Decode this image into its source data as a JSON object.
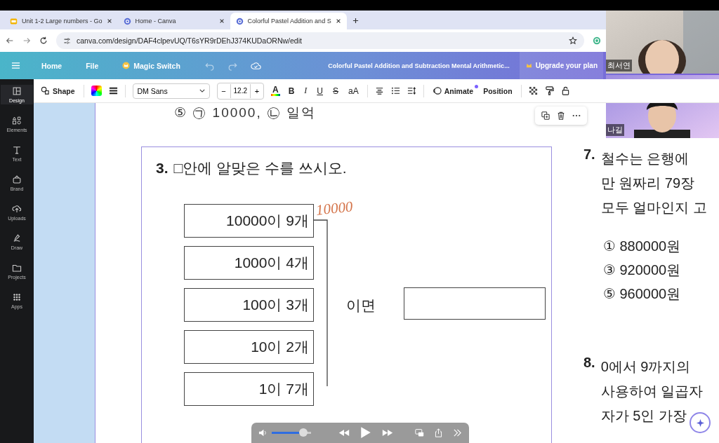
{
  "browser": {
    "tabs": [
      {
        "title": "Unit 1-2 Large numbers - Go",
        "kind": "slides",
        "selected": false
      },
      {
        "title": "Home - Canva",
        "kind": "canva",
        "selected": false
      },
      {
        "title": "Colorful Pastel Addition and S",
        "kind": "canva",
        "selected": true
      }
    ],
    "url": "canva.com/design/DAF4clpevUQ/T6sYR9rDEhJ374KUDaORNw/edit"
  },
  "editor_header": {
    "menu": [
      {
        "label": "Home",
        "kind": "plain"
      },
      {
        "label": "File",
        "kind": "plain"
      },
      {
        "label": "Magic Switch",
        "kind": "crown"
      }
    ],
    "doc_title": "Colorful Pastel Addition and Subtraction Mental Arithmetic...",
    "upgrade": "Upgrade your plan"
  },
  "toolbar": {
    "shape": "Shape",
    "font": "DM Sans",
    "minus": "−",
    "font_size": "12.2",
    "plus": "+",
    "text_color": "A",
    "formats": [
      "B",
      "I",
      "U",
      "S",
      "aA"
    ],
    "animate": "Animate",
    "position": "Position"
  },
  "sidebar": [
    {
      "label": "Design",
      "selected": true
    },
    {
      "label": "Elements",
      "selected": false
    },
    {
      "label": "Text",
      "selected": false
    },
    {
      "label": "Brand",
      "selected": false
    },
    {
      "label": "Uploads",
      "selected": false
    },
    {
      "label": "Draw",
      "selected": false
    },
    {
      "label": "Projects",
      "selected": false
    },
    {
      "label": "Apps",
      "selected": false
    }
  ],
  "page": {
    "cut_line": "⑤ ㉠ 10000,  ㉡ 일억",
    "question": {
      "number": "3.",
      "text": "□안에 알맞은 수를 쓰시오.",
      "rows": [
        "10000이 9개",
        "1000이 4개",
        "100이 3개",
        "10이 2개",
        "1이 7개"
      ],
      "handwriting": "10000",
      "connector": "이면"
    },
    "right": [
      {
        "kind": "question",
        "number": "7.",
        "lines": [
          "철수는  은행에",
          "만  원짜리  79장",
          "모두  얼마인지  고"
        ]
      },
      {
        "kind": "options",
        "lines": [
          "①  880000원",
          "③  920000원",
          "⑤  960000원"
        ]
      },
      {
        "kind": "question",
        "number": "8.",
        "lines": [
          "0에서  9까지의",
          "사용하여  일곱자",
          "자가  5인  가장"
        ]
      }
    ]
  },
  "video_tiles": [
    {
      "name": "최서연",
      "kind": "room"
    },
    {
      "name": "나길",
      "kind": "purple"
    }
  ],
  "player": {
    "volume": {
      "level": 0.8
    }
  }
}
